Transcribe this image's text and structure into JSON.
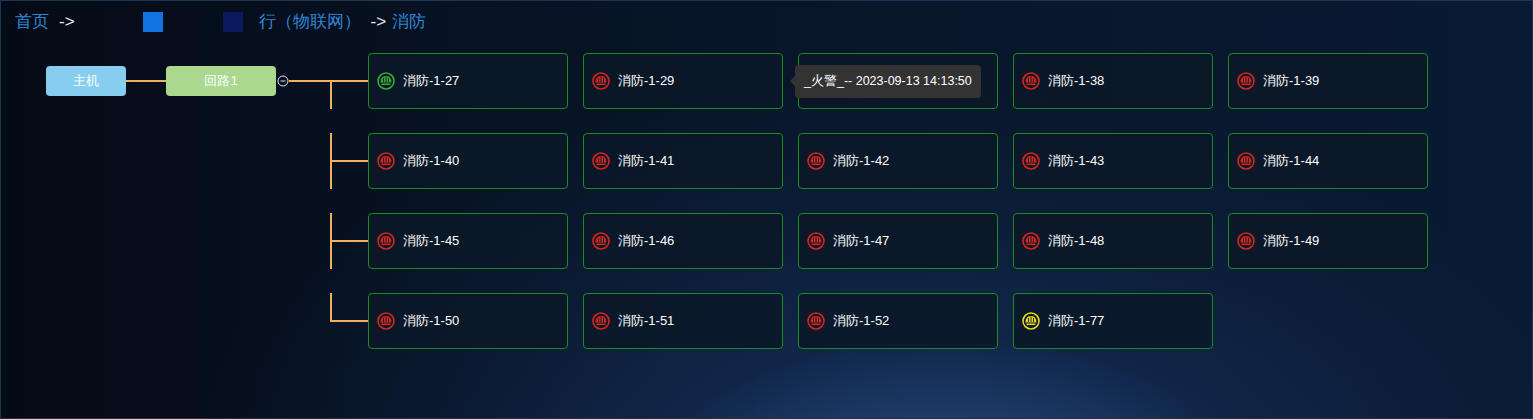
{
  "breadcrumb": [
    {
      "label": "首页",
      "selected": false
    },
    {
      "label": "行（物联网）",
      "selected": false
    },
    {
      "label": "消防",
      "selected": true
    }
  ],
  "separators": [
    "->",
    "->"
  ],
  "tree": {
    "host": {
      "label": "主机"
    },
    "loop": {
      "label": "回路1",
      "expanded": true
    }
  },
  "devices": [
    {
      "name": "消防-1-27",
      "color": "#3aa832"
    },
    {
      "name": "消防-1-29",
      "color": "#d9261c"
    },
    {
      "name": "",
      "tooltip": "_火警_-- 2023-09-13 14:13:50"
    },
    {
      "name": "消防-1-38",
      "color": "#d9261c"
    },
    {
      "name": "消防-1-39",
      "color": "#d9261c"
    },
    {
      "name": "消防-1-40",
      "color": "#d9261c"
    },
    {
      "name": "消防-1-41",
      "color": "#d9261c"
    },
    {
      "name": "消防-1-42",
      "color": "#d9261c"
    },
    {
      "name": "消防-1-43",
      "color": "#d9261c"
    },
    {
      "name": "消防-1-44",
      "color": "#d9261c"
    },
    {
      "name": "消防-1-45",
      "color": "#d9261c"
    },
    {
      "name": "消防-1-46",
      "color": "#d9261c"
    },
    {
      "name": "消防-1-47",
      "color": "#d9261c"
    },
    {
      "name": "消防-1-48",
      "color": "#d9261c"
    },
    {
      "name": "消防-1-49",
      "color": "#d9261c"
    },
    {
      "name": "消防-1-50",
      "color": "#d9261c"
    },
    {
      "name": "消防-1-51",
      "color": "#d9261c"
    },
    {
      "name": "消防-1-52",
      "color": "#d9261c"
    },
    {
      "name": "消防-1-77",
      "color": "#e8d81c"
    }
  ]
}
